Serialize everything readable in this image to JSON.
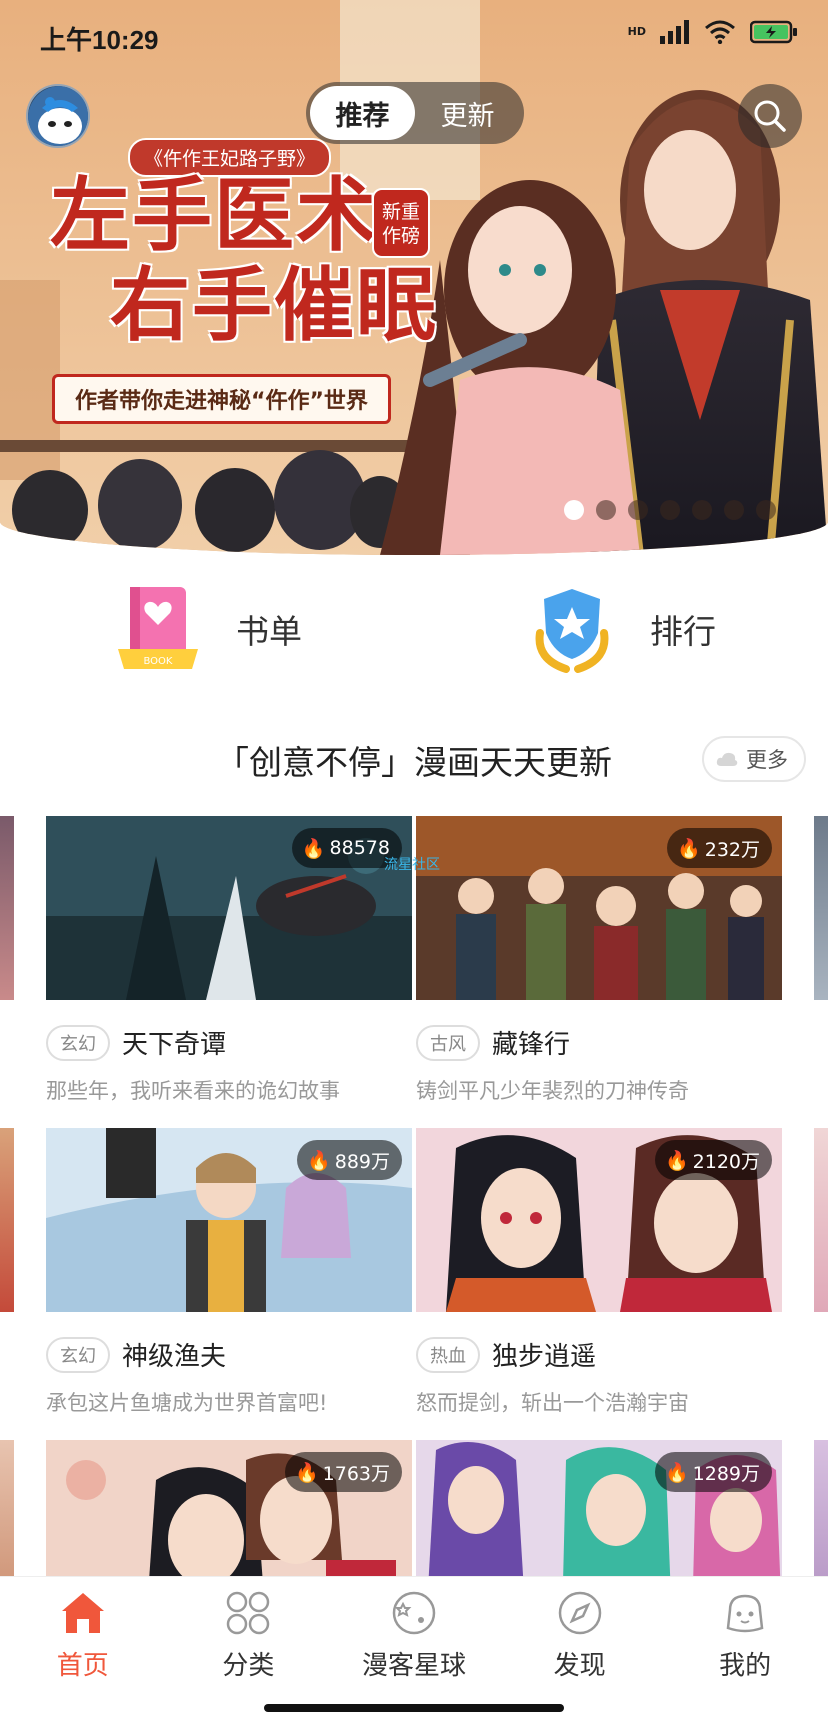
{
  "status_bar": {
    "time": "上午10:29",
    "hd": "HD"
  },
  "header": {
    "tabs": [
      {
        "label": "推荐",
        "active": true
      },
      {
        "label": "更新",
        "active": false
      }
    ]
  },
  "banner": {
    "series": "《仵作王妃路子野》",
    "title_line1": "左手医术",
    "title_line2": "右手催眠",
    "badge": "新重作磅",
    "subtitle": "作者带你走进神秘“仵作”世界",
    "page_count": 7,
    "active_page": 0
  },
  "quick_entries": [
    {
      "label": "书单",
      "icon": "booklist-icon"
    },
    {
      "label": "排行",
      "icon": "ranking-shield-icon"
    }
  ],
  "section": {
    "title": "「创意不停」漫画天天更新",
    "more_label": "更多"
  },
  "watermark": "流星社区",
  "comics": [
    {
      "genre": "玄幻",
      "title": "天下奇谭",
      "desc": "那些年，我听来看来的诡幻故事",
      "heat": "88578"
    },
    {
      "genre": "古风",
      "title": "藏锋行",
      "desc": "铸剑平凡少年裴烈的刀神传奇",
      "heat": "232万"
    },
    {
      "genre": "玄幻",
      "title": "神级渔夫",
      "desc": "承包这片鱼塘成为世界首富吧!",
      "heat": "889万"
    },
    {
      "genre": "热血",
      "title": "独步逍遥",
      "desc": "怒而提剑，斩出一个浩瀚宇宙",
      "heat": "2120万"
    },
    {
      "genre": "",
      "title": "",
      "desc": "",
      "heat": "1763万"
    },
    {
      "genre": "",
      "title": "",
      "desc": "",
      "heat": "1289万"
    }
  ],
  "bottom_nav": [
    {
      "label": "首页",
      "icon": "home-icon",
      "active": true
    },
    {
      "label": "分类",
      "icon": "category-icon",
      "active": false
    },
    {
      "label": "漫客星球",
      "icon": "planet-icon",
      "active": false
    },
    {
      "label": "发现",
      "icon": "compass-icon",
      "active": false
    },
    {
      "label": "我的",
      "icon": "profile-icon",
      "active": false
    }
  ],
  "colors": {
    "accent": "#f0573b",
    "banner_red": "#c0281e"
  }
}
